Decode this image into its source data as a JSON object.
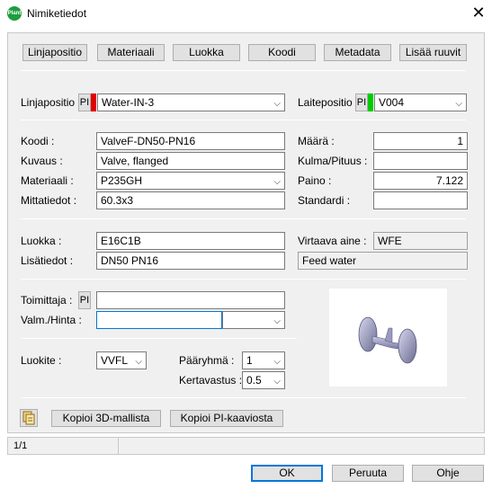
{
  "window": {
    "title": "Nimiketiedot",
    "app_icon_text": "Plant"
  },
  "tabs": [
    "Linjapositio",
    "Materiaali",
    "Luokka",
    "Koodi",
    "Metadata",
    "Lisää ruuvit"
  ],
  "linjapositio": {
    "label": "Linjapositio :",
    "pi": "PI",
    "value": "Water-IN-3",
    "color": "#e00000"
  },
  "laitepositio": {
    "label": "Laitepositio :",
    "pi": "PI",
    "value": "V004",
    "color": "#00cc00"
  },
  "koodi": {
    "label": "Koodi :",
    "value": "ValveF-DN50-PN16"
  },
  "kuvaus": {
    "label": "Kuvaus :",
    "value": "Valve, flanged"
  },
  "materiaali": {
    "label": "Materiaali :",
    "value": "P235GH"
  },
  "mittatiedot": {
    "label": "Mittatiedot :",
    "value": "60.3x3"
  },
  "maara": {
    "label": "Määrä :",
    "value": "1"
  },
  "kulma": {
    "label": "Kulma/Pituus :",
    "value": ""
  },
  "paino": {
    "label": "Paino :",
    "value": "7.122"
  },
  "standardi": {
    "label": "Standardi :",
    "value": ""
  },
  "luokka": {
    "label": "Luokka :",
    "value": "E16C1B"
  },
  "lisatiedot": {
    "label": "Lisätiedot :",
    "value": "DN50 PN16"
  },
  "virtaava": {
    "label": "Virtaava aine :",
    "value": "WFE",
    "description": "Feed water"
  },
  "toimittaja": {
    "label": "Toimittaja :",
    "pi": "PI",
    "value": ""
  },
  "valm": {
    "label": "Valm./Hinta :",
    "value": "",
    "select": ""
  },
  "luokite": {
    "label": "Luokite :",
    "value": "VVFL"
  },
  "paaryhma": {
    "label": "Pääryhmä :",
    "value": "1"
  },
  "kertavastus": {
    "label": "Kertavastus :",
    "value": "0.5"
  },
  "copy_buttons": {
    "from_3d": "Kopioi 3D-mallista",
    "from_pi": "Kopioi PI-kaaviosta"
  },
  "status": {
    "text": "1/1"
  },
  "footer": {
    "ok": "OK",
    "cancel": "Peruuta",
    "help": "Ohje"
  }
}
